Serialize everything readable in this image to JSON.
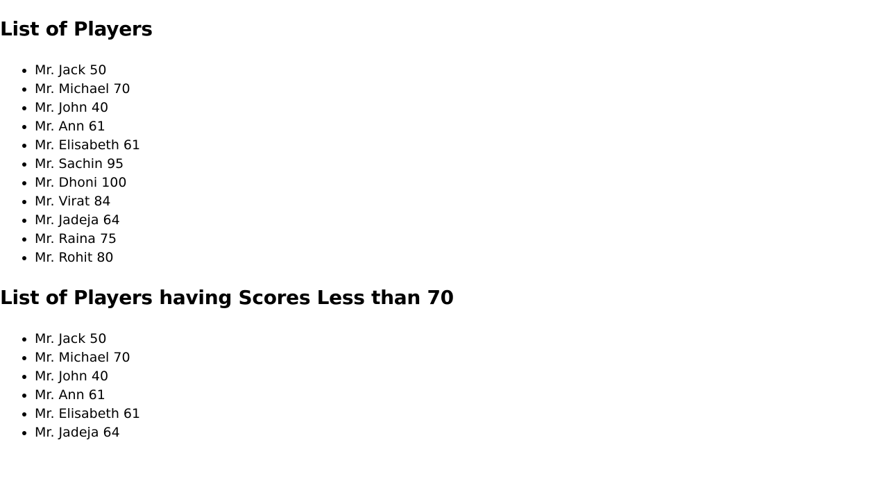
{
  "sections": {
    "all_players": {
      "heading": "List of Players",
      "items": [
        "Mr. Jack 50",
        "Mr. Michael 70",
        "Mr. John 40",
        "Mr. Ann 61",
        "Mr. Elisabeth 61",
        "Mr. Sachin 95",
        "Mr. Dhoni 100",
        "Mr. Virat 84",
        "Mr. Jadeja 64",
        "Mr. Raina 75",
        "Mr. Rohit 80"
      ]
    },
    "less_than_70": {
      "heading": "List of Players having Scores Less than 70",
      "items": [
        "Mr. Jack 50",
        "Mr. Michael 70",
        "Mr. John 40",
        "Mr. Ann 61",
        "Mr. Elisabeth 61",
        "Mr. Jadeja 64"
      ]
    }
  }
}
